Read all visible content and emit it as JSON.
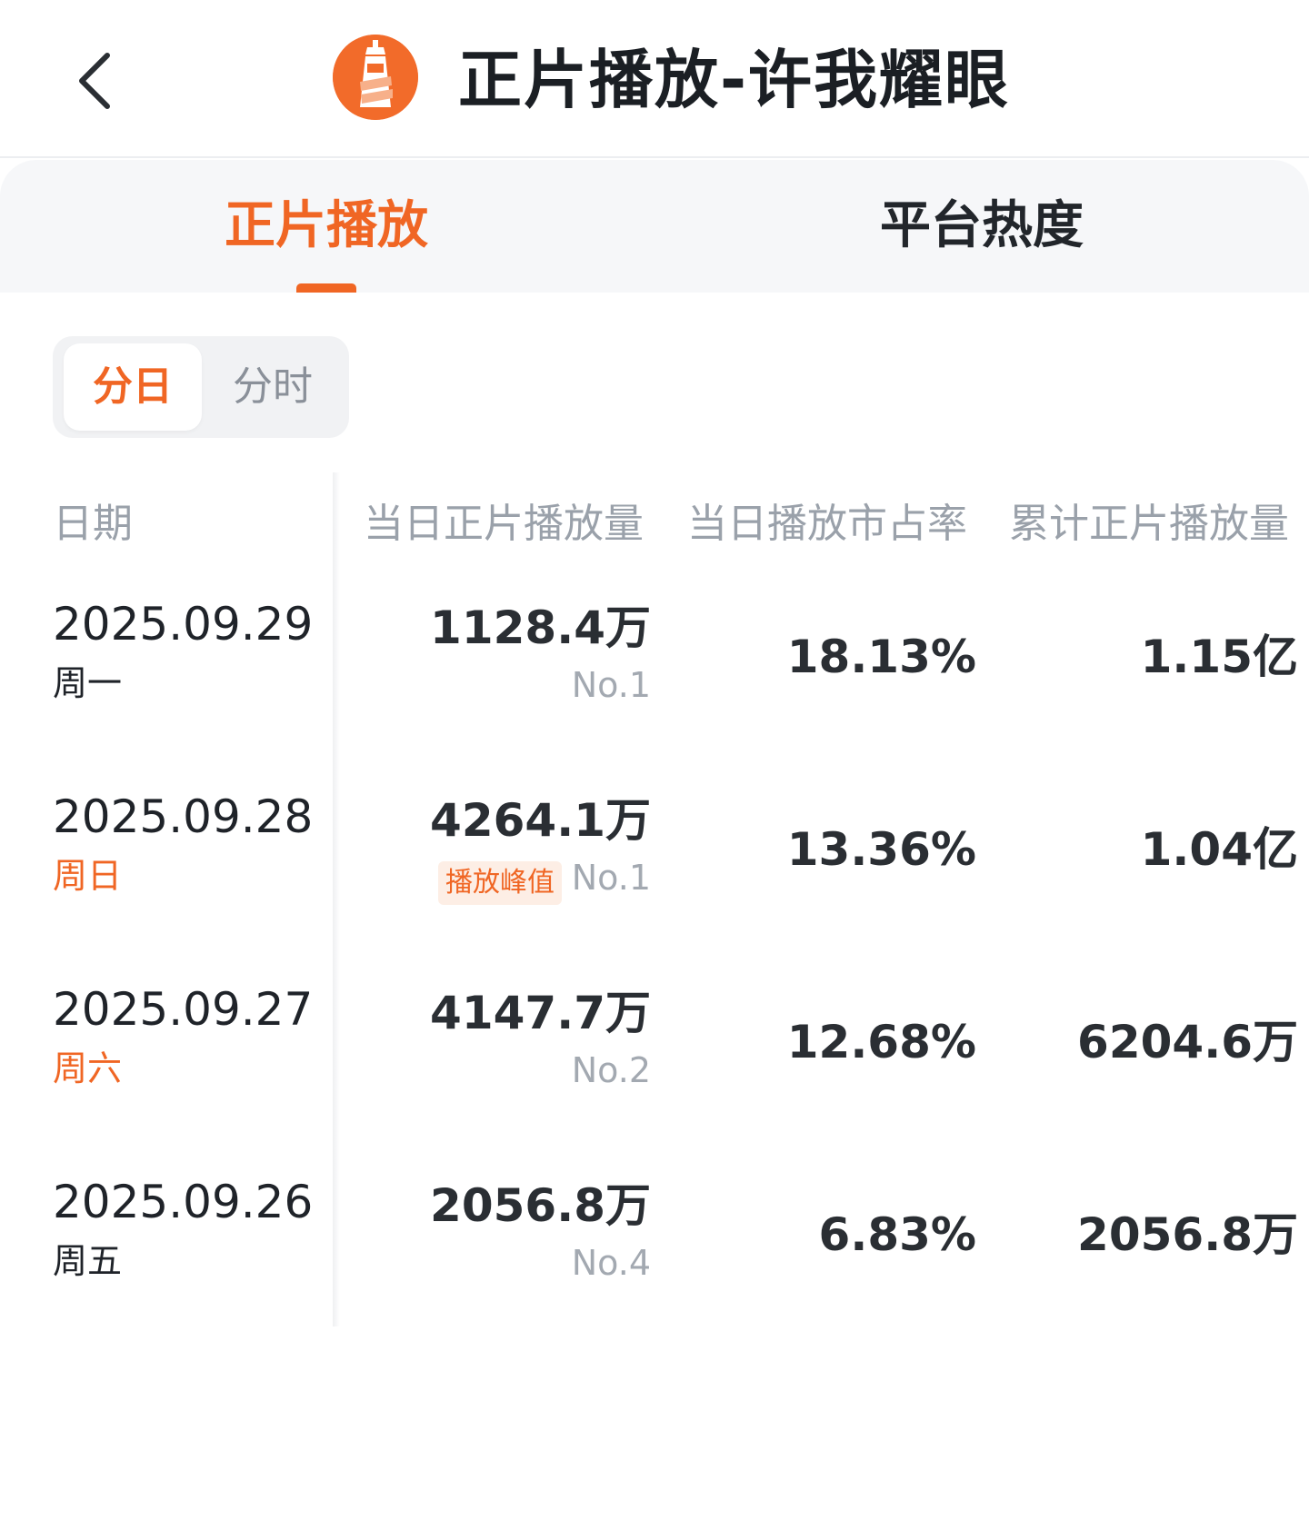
{
  "header": {
    "title": "正片播放-许我耀眼",
    "back_icon": "chevron-left-icon",
    "logo_icon": "lighthouse-logo-icon"
  },
  "tabs": [
    {
      "label": "正片播放",
      "active": true
    },
    {
      "label": "平台热度",
      "active": false
    }
  ],
  "granularity": {
    "options": [
      "分日",
      "分时"
    ],
    "selected": "分日"
  },
  "table": {
    "headers": [
      "日期",
      "当日正片播放量",
      "当日播放市占率",
      "累计正片播放量"
    ],
    "rows": [
      {
        "date": "2025.09.29",
        "weekday": "周一",
        "weekend": false,
        "daily_plays": "1128.4万",
        "badge": "",
        "rank": "No.1",
        "share": "18.13%",
        "total": "1.15亿"
      },
      {
        "date": "2025.09.28",
        "weekday": "周日",
        "weekend": true,
        "daily_plays": "4264.1万",
        "badge": "播放峰值",
        "rank": "No.1",
        "share": "13.36%",
        "total": "1.04亿"
      },
      {
        "date": "2025.09.27",
        "weekday": "周六",
        "weekend": true,
        "daily_plays": "4147.7万",
        "badge": "",
        "rank": "No.2",
        "share": "12.68%",
        "total": "6204.6万"
      },
      {
        "date": "2025.09.26",
        "weekday": "周五",
        "weekend": false,
        "daily_plays": "2056.8万",
        "badge": "",
        "rank": "No.4",
        "share": "6.83%",
        "total": "2056.8万"
      }
    ]
  },
  "colors": {
    "accent": "#f06624",
    "text_primary": "#1f2329",
    "text_muted": "#9aa1aa",
    "badge_bg": "#fdeee5"
  }
}
